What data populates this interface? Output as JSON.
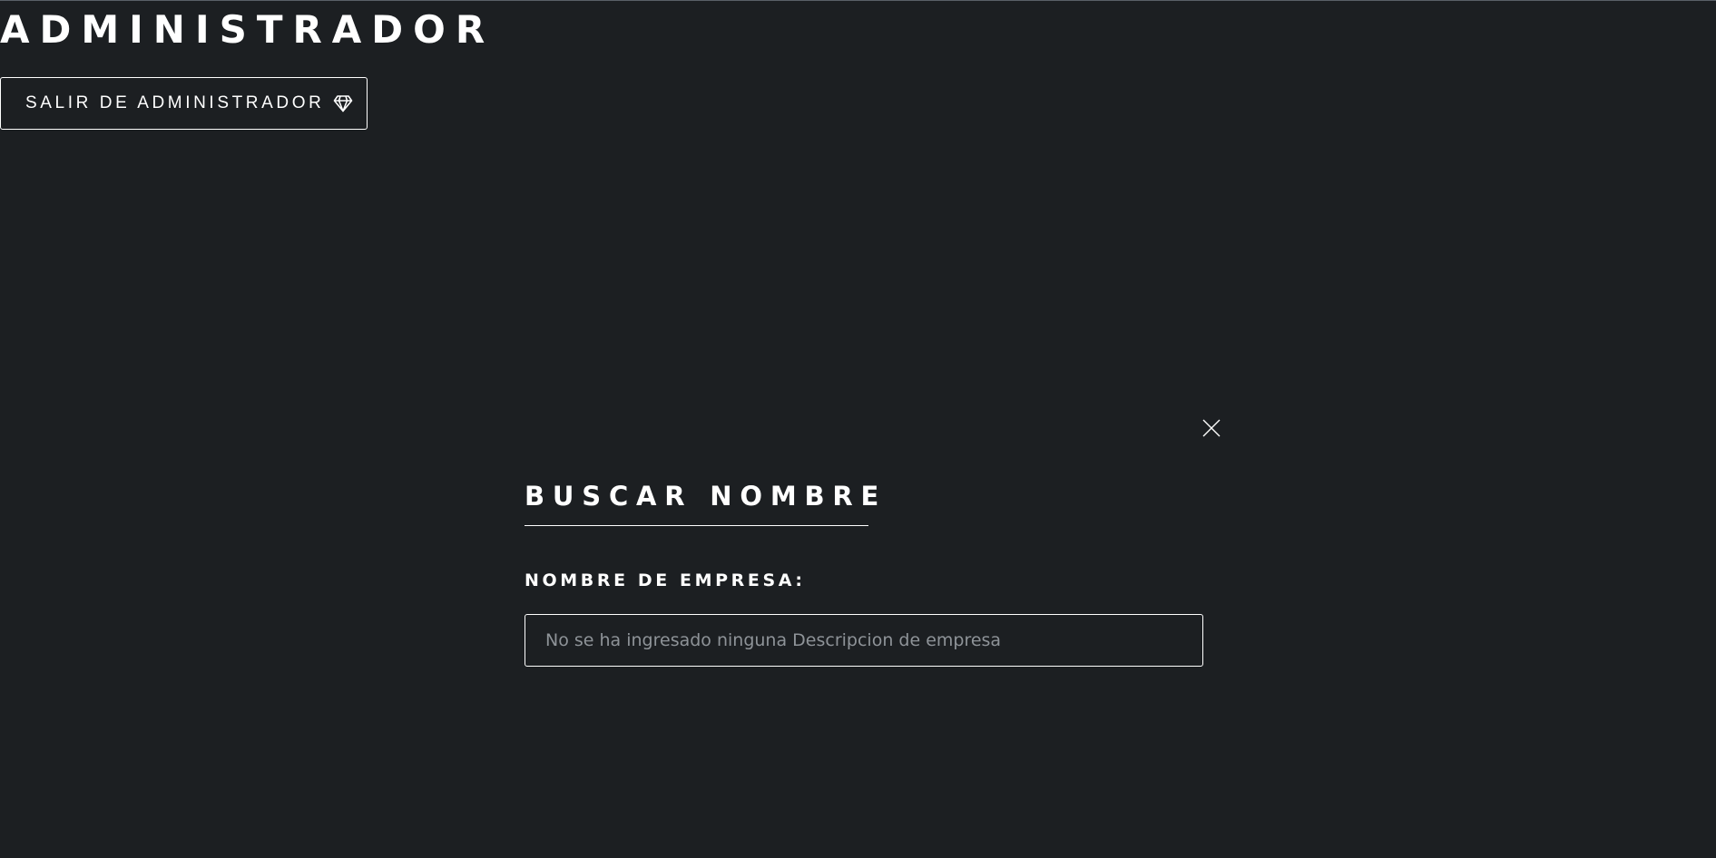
{
  "header": {
    "title": "ADMINISTRADOR",
    "exit_button_label": "SALIR DE ADMINISTRADOR",
    "exit_button_icon": "diamond-icon"
  },
  "search_panel": {
    "close_icon": "close-icon",
    "heading": "BUSCAR NOMBRE",
    "field_label": "NOMBRE DE EMPRESA:",
    "input_value": "",
    "input_placeholder": "No se ha ingresado ninguna Descripcion de empresa"
  },
  "colors": {
    "background": "#1c1f22",
    "foreground": "#ffffff",
    "placeholder": "#8e9398"
  }
}
